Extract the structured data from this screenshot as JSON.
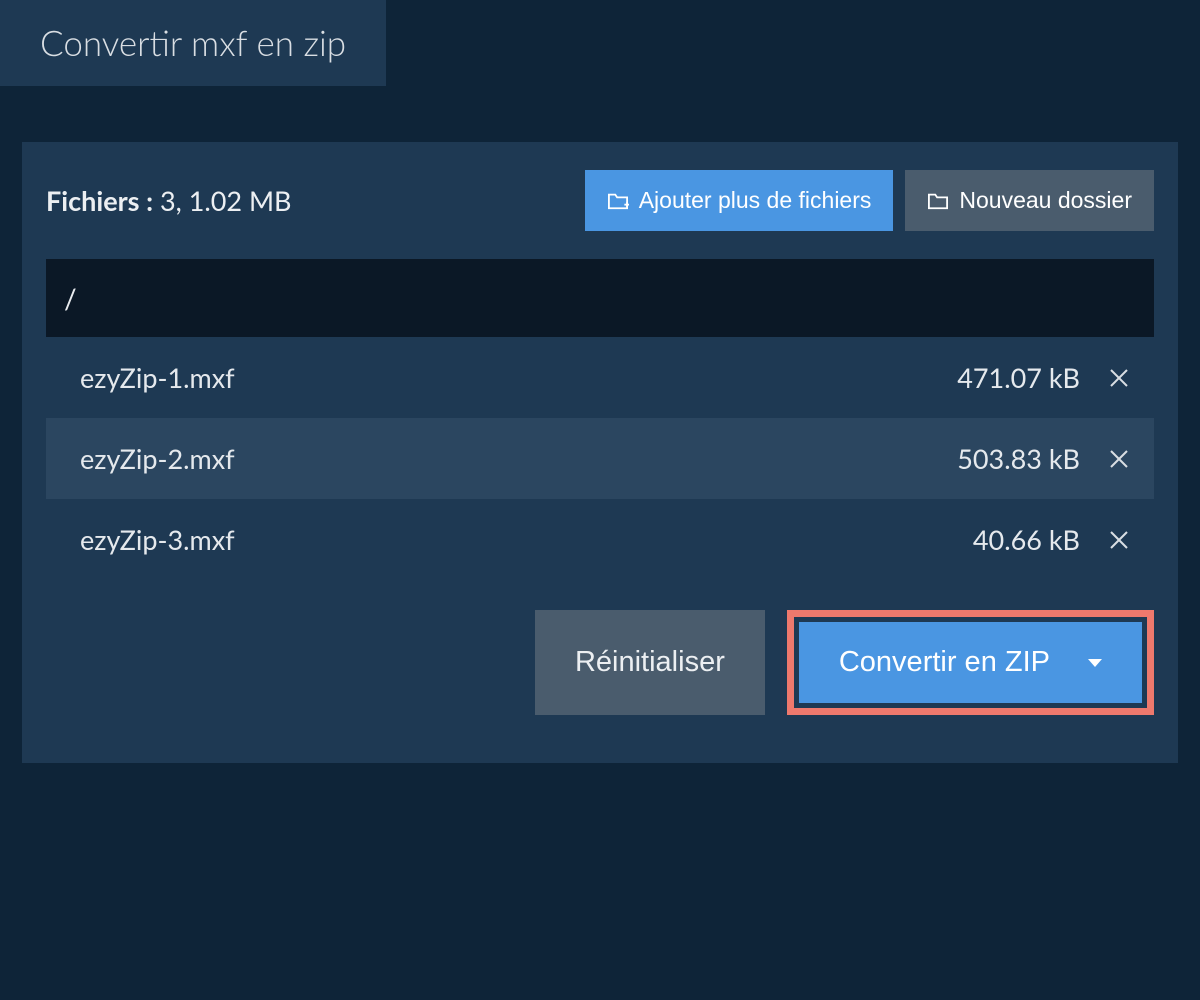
{
  "tab": {
    "title": "Convertir mxf en zip"
  },
  "header": {
    "files_label": "Fichiers :",
    "files_count": "3,",
    "files_size": "1.02 MB",
    "add_button": "Ajouter plus de fichiers",
    "new_folder_button": "Nouveau dossier"
  },
  "path": "/",
  "files": [
    {
      "name": "ezyZip-1.mxf",
      "size": "471.07 kB"
    },
    {
      "name": "ezyZip-2.mxf",
      "size": "503.83 kB"
    },
    {
      "name": "ezyZip-3.mxf",
      "size": "40.66 kB"
    }
  ],
  "footer": {
    "reset": "Réinitialiser",
    "convert": "Convertir en ZIP"
  }
}
